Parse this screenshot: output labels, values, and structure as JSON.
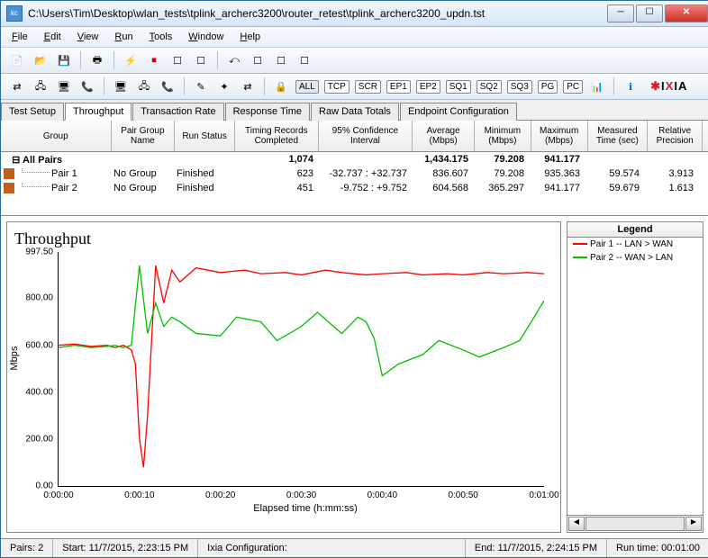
{
  "window": {
    "title": "C:\\Users\\Tim\\Desktop\\wlan_tests\\tplink_archerc3200\\router_retest\\tplink_archerc3200_updn.tst"
  },
  "menu": {
    "file": "File",
    "edit": "Edit",
    "view": "View",
    "run": "Run",
    "tools": "Tools",
    "window": "Window",
    "help": "Help"
  },
  "toolbar2": {
    "all": "ALL",
    "tcp": "TCP",
    "scr": "SCR",
    "ep1": "EP1",
    "ep2": "EP2",
    "sq1": "SQ1",
    "sq2": "SQ2",
    "sq3": "SQ3",
    "pg": "PG",
    "pc": "PC"
  },
  "tabs": {
    "testsetup": "Test Setup",
    "throughput": "Throughput",
    "transrate": "Transaction Rate",
    "resptime": "Response Time",
    "rawdata": "Raw Data Totals",
    "endpoint": "Endpoint Configuration"
  },
  "grid": {
    "headers": {
      "group": "Group",
      "pgname": "Pair Group\nName",
      "runstat": "Run Status",
      "timing": "Timing Records\nCompleted",
      "conf": "95% Confidence\nInterval",
      "avg": "Average\n(Mbps)",
      "min": "Minimum\n(Mbps)",
      "max": "Maximum\n(Mbps)",
      "meas": "Measured\nTime (sec)",
      "rel": "Relative\nPrecision"
    },
    "total": {
      "group": "All Pairs",
      "timing": "1,074",
      "avg": "1,434.175",
      "min": "79.208",
      "max": "941.177"
    },
    "rows": [
      {
        "group": "Pair 1",
        "pg": "No Group",
        "run": "Finished",
        "timing": "623",
        "conf": "-32.737 : +32.737",
        "avg": "836.607",
        "min": "79.208",
        "max": "935.363",
        "meas": "59.574",
        "rel": "3.913"
      },
      {
        "group": "Pair 2",
        "pg": "No Group",
        "run": "Finished",
        "timing": "451",
        "conf": "-9.752 : +9.752",
        "avg": "604.568",
        "min": "365.297",
        "max": "941.177",
        "meas": "59.679",
        "rel": "1.613"
      }
    ]
  },
  "chart": {
    "title": "Throughput",
    "ylabel": "Mbps",
    "xlabel": "Elapsed time (h:mm:ss)"
  },
  "chart_data": {
    "type": "line",
    "xlabel": "Elapsed time (h:mm:ss)",
    "ylabel": "Mbps",
    "ylim": [
      0,
      997.5
    ],
    "yticks": [
      0,
      200,
      400,
      600,
      800,
      997.5
    ],
    "xticks": [
      "0:00:00",
      "0:00:10",
      "0:00:20",
      "0:00:30",
      "0:00:40",
      "0:00:50",
      "0:01:00"
    ],
    "series": [
      {
        "name": "Pair 1 -- LAN > WAN",
        "color": "#ff0000",
        "x": [
          0,
          2,
          4,
          6,
          7,
          8,
          9,
          9.5,
          10,
          10.5,
          11,
          12,
          13,
          14,
          15,
          17,
          20,
          23,
          25,
          28,
          30,
          33,
          35,
          38,
          40,
          43,
          45,
          48,
          50,
          53,
          55,
          58,
          60
        ],
        "y": [
          600,
          605,
          595,
          600,
          590,
          600,
          580,
          520,
          200,
          80,
          300,
          940,
          780,
          920,
          870,
          930,
          910,
          920,
          905,
          910,
          900,
          920,
          910,
          900,
          905,
          910,
          900,
          905,
          900,
          910,
          905,
          910,
          905
        ]
      },
      {
        "name": "Pair 2 -- WAN > LAN",
        "color": "#00c000",
        "x": [
          0,
          2,
          4,
          6,
          7,
          8,
          9,
          10,
          11,
          12,
          13,
          14,
          15,
          17,
          20,
          22,
          25,
          27,
          30,
          32,
          35,
          37,
          38,
          39,
          40,
          42,
          45,
          47,
          50,
          52,
          55,
          57,
          60
        ],
        "y": [
          590,
          600,
          590,
          595,
          600,
          590,
          600,
          940,
          650,
          780,
          680,
          720,
          700,
          650,
          640,
          720,
          700,
          620,
          680,
          740,
          650,
          720,
          700,
          630,
          470,
          520,
          560,
          620,
          580,
          550,
          590,
          620,
          790
        ]
      }
    ]
  },
  "legend": {
    "title": "Legend",
    "p1": "Pair 1 -- LAN > WAN",
    "p2": "Pair 2 -- WAN > LAN"
  },
  "status": {
    "pairs": "Pairs: 2",
    "start": "Start: 11/7/2015, 2:23:15 PM",
    "ixia": "Ixia Configuration:",
    "end": "End: 11/7/2015, 2:24:15 PM",
    "runtime": "Run time: 00:01:00"
  }
}
